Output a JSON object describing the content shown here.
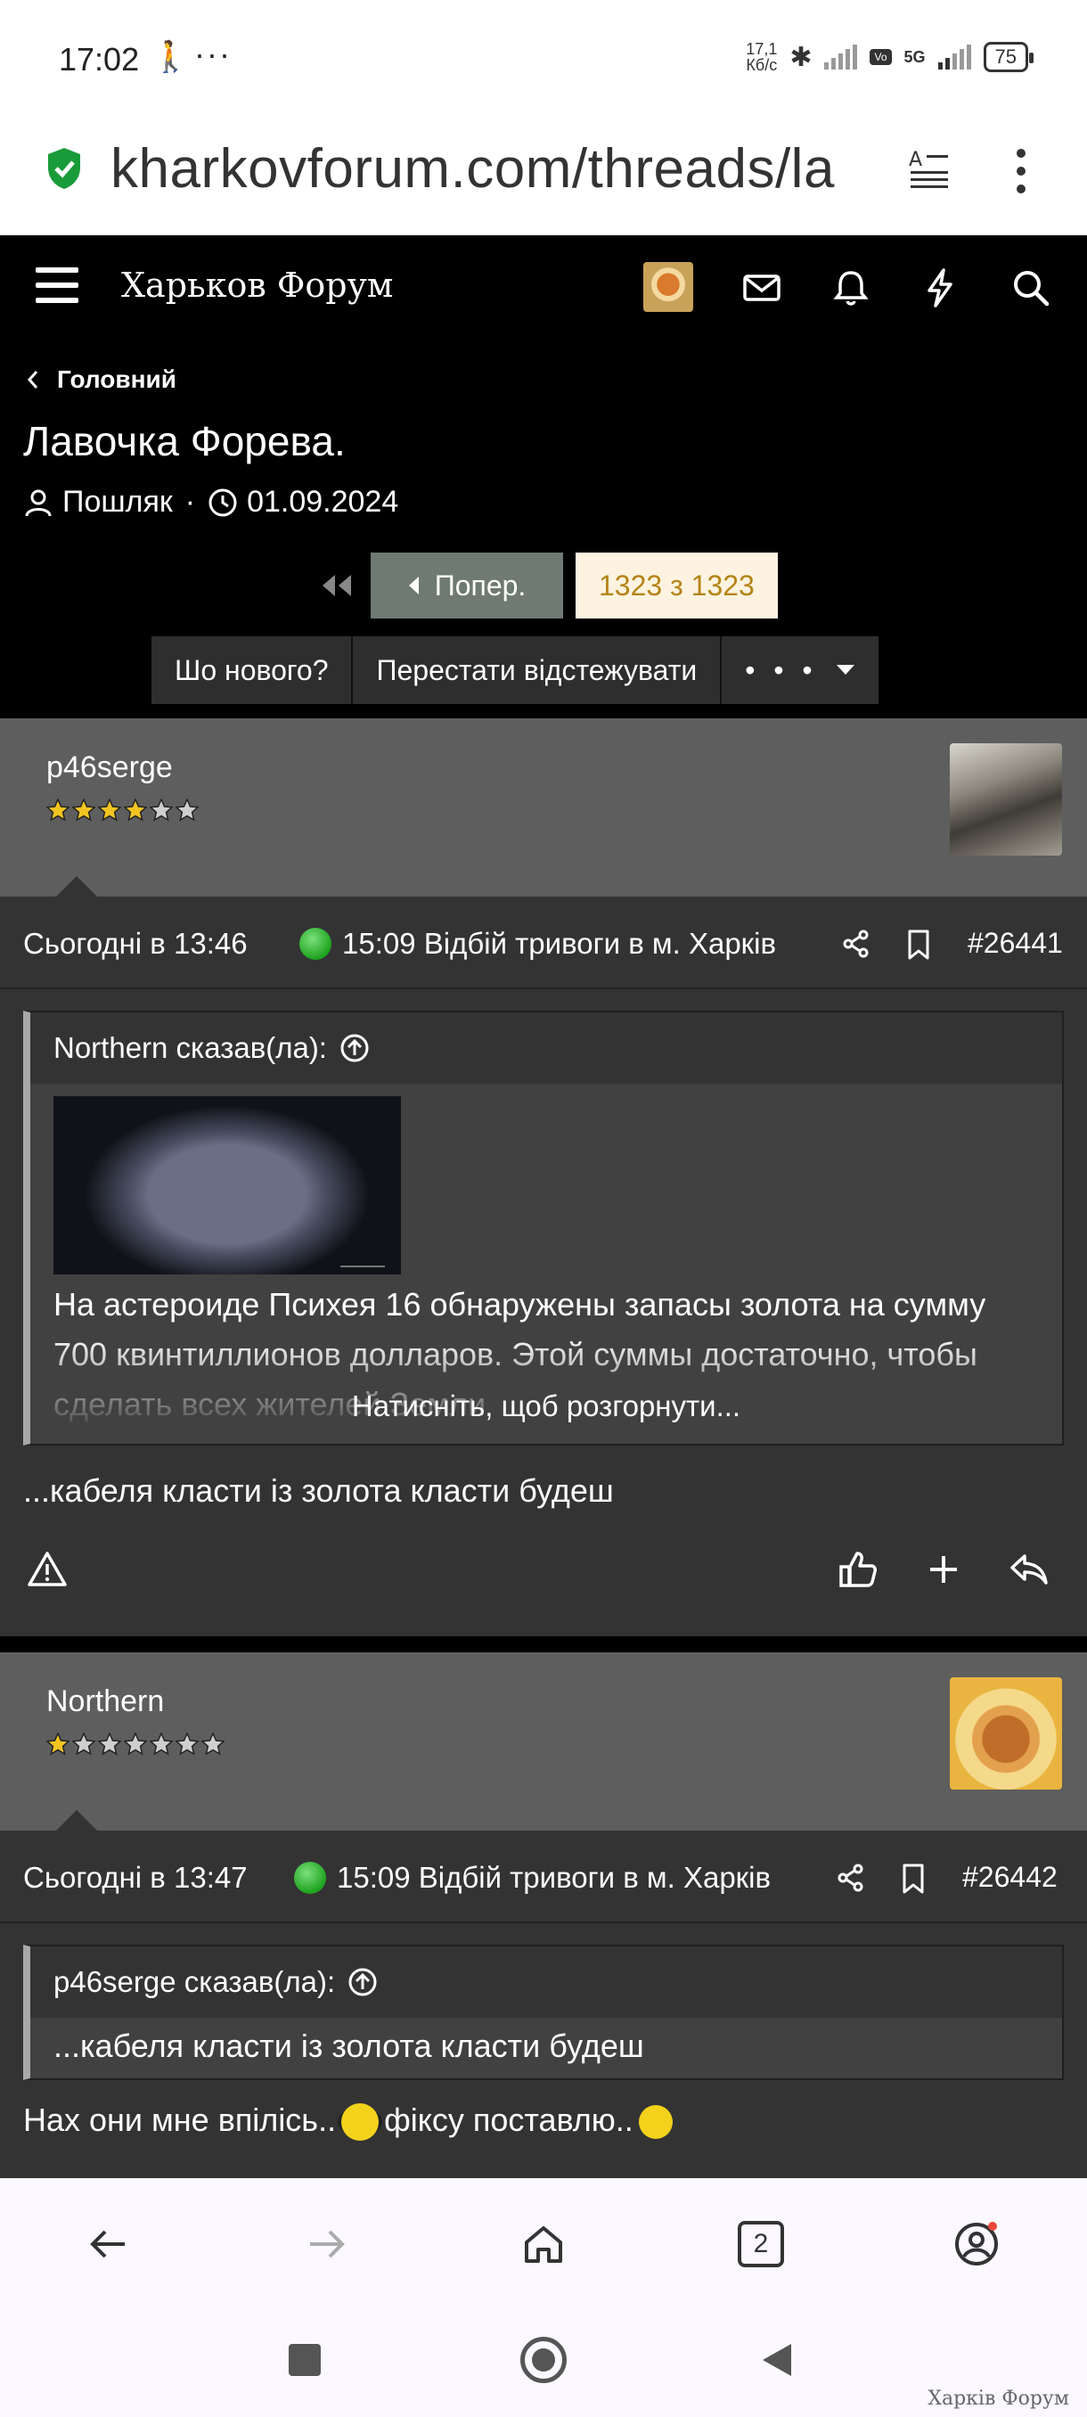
{
  "status_bar": {
    "time": "17:02",
    "speed_value": "17,1",
    "speed_unit": "Кб/с",
    "network": "5G",
    "battery": "75"
  },
  "browser": {
    "url": "kharkovforum.com/threads/la"
  },
  "forum": {
    "logo": "Харьков Форум"
  },
  "thread": {
    "breadcrumb": "Головний",
    "title": "Лавочка Форева.",
    "author": "Пошляк",
    "date": "01.09.2024",
    "prev_label": "Попер.",
    "page_label": "1323 з 1323",
    "actions": [
      "Шо нового?",
      "Перестати відстежувати",
      "• • •"
    ]
  },
  "posts": [
    {
      "username": "p46serge",
      "stars_filled": 4,
      "stars_total": 6,
      "time": "Сьогодні в 13:46",
      "alert": "15:09 Відбій тривоги в м. Харків",
      "number": "#26441",
      "quote_author": "Northern сказав(ла):",
      "quote_text": "На астероиде Психея 16 обнаружены запасы золота на сумму 700 квинтиллионов долларов. Этой суммы достаточно, чтобы сделать всех жителей Земли",
      "expand_label": "Натисніть, щоб розгорнути...",
      "body": "...кабеля класти із золота класти будеш"
    },
    {
      "username": "Northern",
      "stars_filled": 1,
      "stars_total": 7,
      "time": "Сьогодні в 13:47",
      "alert": "15:09 Відбій тривоги в м. Харків",
      "number": "#26442",
      "quote_author": "p46serge сказав(ла):",
      "quote_text": "...кабеля класти із золота класти будеш",
      "body_before": "Нах они мне впілісь..",
      "body_after": "фіксу поставлю.."
    }
  ],
  "bottom_nav": {
    "tabs_count": "2"
  },
  "watermark": "Харків Форум"
}
